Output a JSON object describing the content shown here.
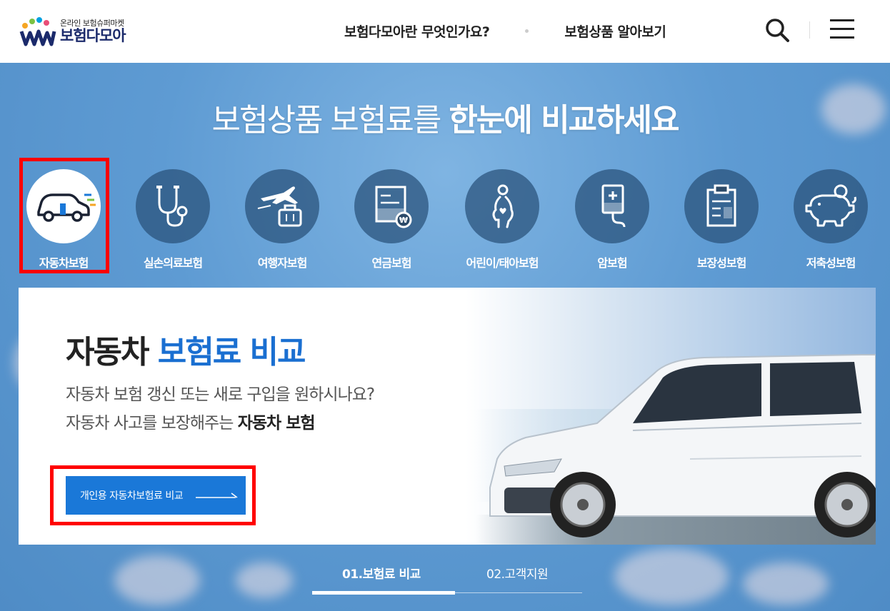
{
  "header": {
    "logo_small": "온라인 보험슈퍼마켓",
    "logo_big": "보험다모아",
    "nav": [
      "보험다모아란 무엇인가요?",
      "보험상품 알아보기"
    ]
  },
  "hero": {
    "title_light": "보험상품 보험료를 ",
    "title_bold": "한눈에 비교하세요"
  },
  "categories": [
    {
      "label": "자동차보험",
      "icon": "car-icon",
      "active": true
    },
    {
      "label": "실손의료보험",
      "icon": "stethoscope-icon"
    },
    {
      "label": "여행자보험",
      "icon": "airplane-luggage-icon"
    },
    {
      "label": "연금보험",
      "icon": "pension-document-icon"
    },
    {
      "label": "어린이/태아보험",
      "icon": "pregnant-icon"
    },
    {
      "label": "암보험",
      "icon": "iv-bag-icon"
    },
    {
      "label": "보장성보험",
      "icon": "clipboard-icon"
    },
    {
      "label": "저축성보험",
      "icon": "piggy-bank-icon"
    }
  ],
  "panel": {
    "title_dark": "자동차 ",
    "title_blue": "보험료 비교",
    "desc_line1": "자동차 보험 갱신 또는 새로 구입을 원하시나요?",
    "desc_line2_plain": "자동차 사고를 보장해주는 ",
    "desc_line2_bold": "자동차 보험",
    "cta_label": "개인용 자동차보험료 비교"
  },
  "tabs": [
    "01.보험료 비교",
    "02.고객지원"
  ],
  "colors": {
    "accent": "#1a78d8",
    "title_blue": "#1a6fd1",
    "highlight": "#ff0000",
    "logo_navy": "#1b2a6b"
  }
}
